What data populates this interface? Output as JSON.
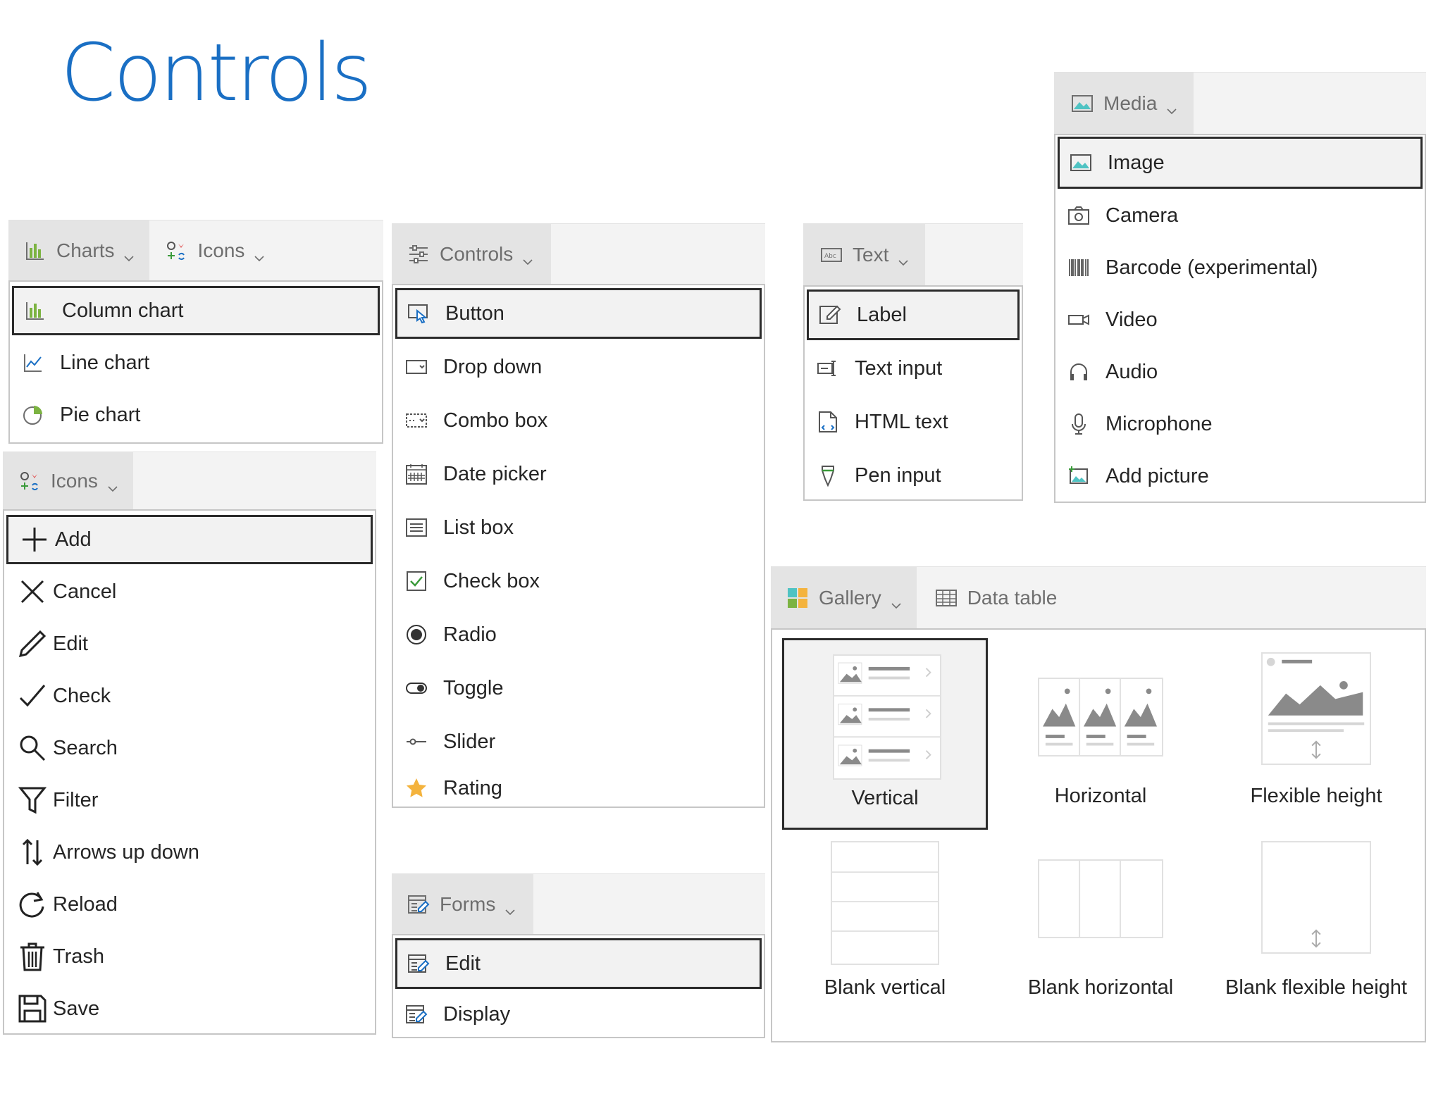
{
  "title": "Controls",
  "charts_panel": {
    "tabs": [
      {
        "label": "Charts"
      },
      {
        "label": "Icons"
      }
    ],
    "items": [
      {
        "label": "Column chart"
      },
      {
        "label": "Line chart"
      },
      {
        "label": "Pie chart"
      }
    ],
    "selected": "Column chart"
  },
  "icons_panel": {
    "tab": {
      "label": "Icons"
    },
    "items": [
      {
        "label": "Add"
      },
      {
        "label": "Cancel"
      },
      {
        "label": "Edit"
      },
      {
        "label": "Check"
      },
      {
        "label": "Search"
      },
      {
        "label": "Filter"
      },
      {
        "label": "Arrows up down"
      },
      {
        "label": "Reload"
      },
      {
        "label": "Trash"
      },
      {
        "label": "Save"
      }
    ],
    "selected": "Add"
  },
  "controls_panel": {
    "tab": {
      "label": "Controls"
    },
    "items": [
      {
        "label": "Button"
      },
      {
        "label": "Drop down"
      },
      {
        "label": "Combo box"
      },
      {
        "label": "Date picker"
      },
      {
        "label": "List box"
      },
      {
        "label": "Check box"
      },
      {
        "label": "Radio"
      },
      {
        "label": "Toggle"
      },
      {
        "label": "Slider"
      },
      {
        "label": "Rating"
      }
    ],
    "selected": "Button"
  },
  "forms_panel": {
    "tab": {
      "label": "Forms"
    },
    "items": [
      {
        "label": "Edit"
      },
      {
        "label": "Display"
      }
    ],
    "selected": "Edit"
  },
  "text_panel": {
    "tab": {
      "label": "Text"
    },
    "items": [
      {
        "label": "Label"
      },
      {
        "label": "Text input"
      },
      {
        "label": "HTML text"
      },
      {
        "label": "Pen input"
      }
    ],
    "selected": "Label"
  },
  "media_panel": {
    "tab": {
      "label": "Media"
    },
    "items": [
      {
        "label": "Image"
      },
      {
        "label": "Camera"
      },
      {
        "label": "Barcode (experimental)"
      },
      {
        "label": "Video"
      },
      {
        "label": "Audio"
      },
      {
        "label": "Microphone"
      },
      {
        "label": "Add picture"
      }
    ],
    "selected": "Image"
  },
  "gallery_panel": {
    "tabs": [
      {
        "label": "Gallery"
      },
      {
        "label": "Data table"
      }
    ],
    "items": [
      {
        "label": "Vertical"
      },
      {
        "label": "Horizontal"
      },
      {
        "label": "Flexible height"
      },
      {
        "label": "Blank vertical"
      },
      {
        "label": "Blank horizontal"
      },
      {
        "label": "Blank flexible height"
      }
    ],
    "selected": "Vertical"
  },
  "colors": {
    "accent": "#1a6fc4",
    "tab_bg": "#f3f3f3",
    "tab_active": "#e4e4e4",
    "border": "#c6c6c6",
    "selected_border": "#2b2b2b",
    "icon_gray": "#6e6e6e",
    "chart_green": "#7cb342",
    "rating_gold": "#f4b33d"
  }
}
